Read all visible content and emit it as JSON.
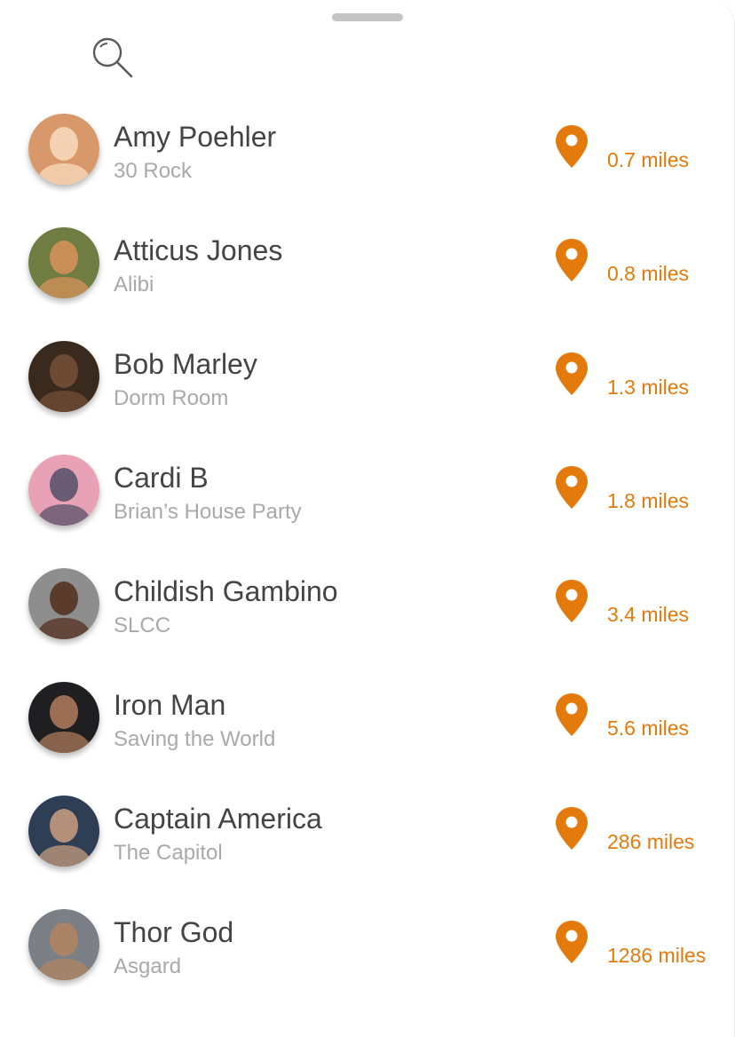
{
  "accent_color": "#e57a0c",
  "search": {
    "icon": "search-icon"
  },
  "people": [
    {
      "name": "Amy Poehler",
      "venue": "30 Rock",
      "distance": "0.7 miles",
      "avatar_bg": "#d9986a",
      "avatar_fg": "#f3d2b4"
    },
    {
      "name": "Atticus Jones",
      "venue": "Alibi",
      "distance": "0.8 miles",
      "avatar_bg": "#6f7d42",
      "avatar_fg": "#c98f56"
    },
    {
      "name": "Bob Marley",
      "venue": "Dorm Room",
      "distance": "1.3 miles",
      "avatar_bg": "#3a2a1e",
      "avatar_fg": "#6d4a33"
    },
    {
      "name": "Cardi B",
      "venue": "Brian’s House Party",
      "distance": "1.8 miles",
      "avatar_bg": "#e8a1b5",
      "avatar_fg": "#6a5b74"
    },
    {
      "name": "Childish Gambino",
      "venue": "SLCC",
      "distance": "3.4 miles",
      "avatar_bg": "#8e8e8e",
      "avatar_fg": "#5b3b2b"
    },
    {
      "name": "Iron Man",
      "venue": "Saving the World",
      "distance": "5.6 miles",
      "avatar_bg": "#1f1f22",
      "avatar_fg": "#9c6e53"
    },
    {
      "name": "Captain America",
      "venue": "The Capitol",
      "distance": "286 miles",
      "avatar_bg": "#2d3e55",
      "avatar_fg": "#b48f79"
    },
    {
      "name": "Thor God",
      "venue": "Asgard",
      "distance": "1286 miles",
      "avatar_bg": "#7b7f86",
      "avatar_fg": "#a98364"
    }
  ]
}
